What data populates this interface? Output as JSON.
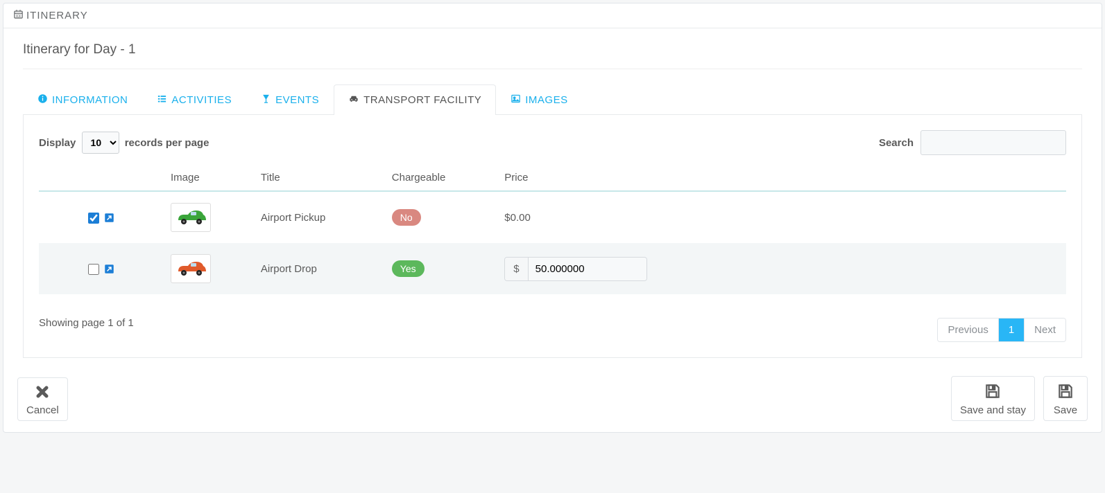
{
  "header": {
    "title": "ITINERARY"
  },
  "subtitle": "Itinerary for Day - 1",
  "tabs": {
    "information": "INFORMATION",
    "activities": "ACTIVITIES",
    "events": "EVENTS",
    "transport": "TRANSPORT FACILITY",
    "images": "IMAGES"
  },
  "table_controls": {
    "display_label_pre": "Display",
    "display_label_post": "records per page",
    "display_value": "10",
    "search_label": "Search"
  },
  "columns": {
    "image": "Image",
    "title": "Title",
    "chargeable": "Chargeable",
    "price": "Price"
  },
  "rows": [
    {
      "checked": true,
      "title": "Airport Pickup",
      "chargeable": "No",
      "price_display": "$0.00",
      "car_color": "#3aa53a"
    },
    {
      "checked": false,
      "title": "Airport Drop",
      "chargeable": "Yes",
      "price_input": "50.000000",
      "currency_symbol": "$",
      "car_color": "#e05a2b"
    }
  ],
  "footer": {
    "showing": "Showing page 1 of 1",
    "prev": "Previous",
    "page": "1",
    "next": "Next"
  },
  "actions": {
    "cancel": "Cancel",
    "save_stay": "Save and stay",
    "save": "Save"
  }
}
